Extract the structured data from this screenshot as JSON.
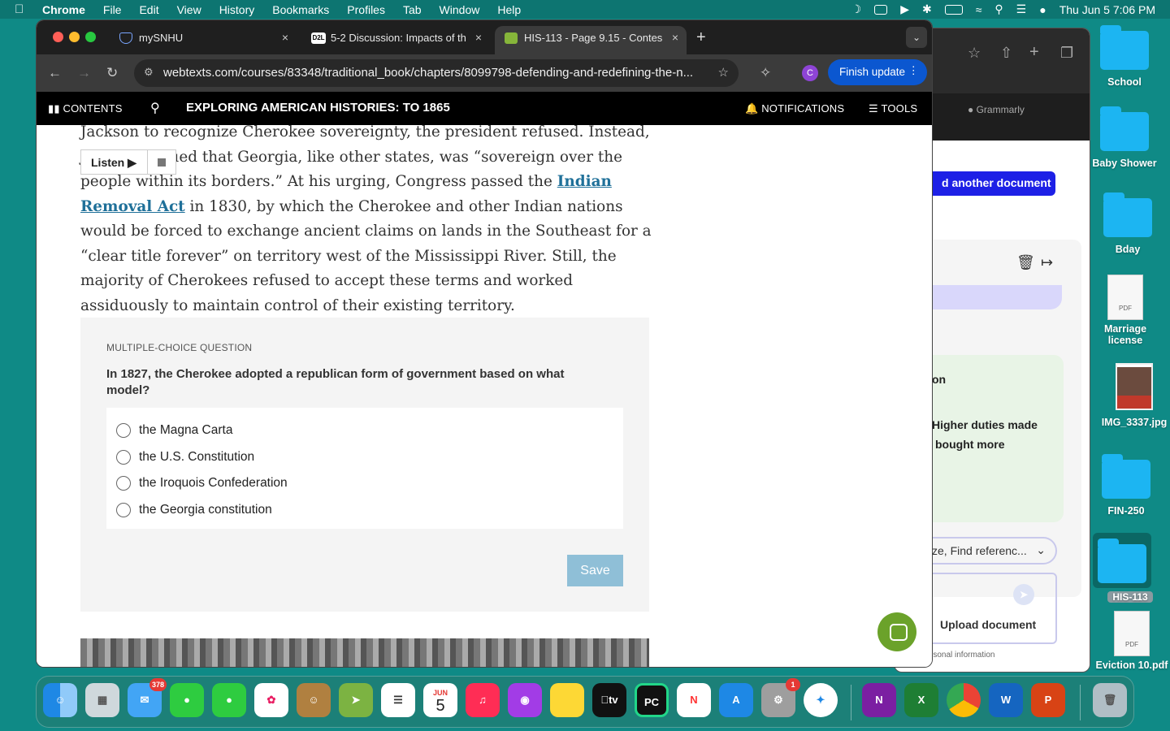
{
  "menubar": {
    "app": "Chrome",
    "items": [
      "File",
      "Edit",
      "View",
      "History",
      "Bookmarks",
      "Profiles",
      "Tab",
      "Window",
      "Help"
    ],
    "datetime": "Thu Jun 5  7:06 PM"
  },
  "desktop": {
    "icons": [
      "School",
      "Baby Shower",
      "Bday",
      "Marriage license",
      "IMG_3337.jpg",
      "FIN-250",
      "HIS-113",
      "Eviction 10.pdf"
    ],
    "pdf_label": "PDF"
  },
  "tabs": [
    {
      "title": "mySNHU",
      "close": "×"
    },
    {
      "title": "5-2 Discussion: Impacts of th",
      "close": "×",
      "favicon": "D2L"
    },
    {
      "title": "HIS-113 - Page 9.15 - Contes",
      "close": "×"
    }
  ],
  "toolbar": {
    "url": "webtexts.com/courses/83348/traditional_book/chapters/8099798-defending-and-redefining-the-n...",
    "profile_initial": "C",
    "finish_update": "Finish update"
  },
  "app_header": {
    "contents": "CONTENTS",
    "title": "EXPLORING AMERICAN HISTORIES: TO 1865",
    "notifications": "NOTIFICATIONS",
    "tools": "TOOLS"
  },
  "article": {
    "listen": "Listen",
    "text_before": "Jackson to recognize Cherokee sovereignty, the president refused. Instead, Jackson argued that Georgia, like other states, was “sovereign over the people within its borders.” At his urging, Congress passed the ",
    "link": "Indian Removal Act",
    "text_after": " in 1830, by which the Cherokee and other Indian nations would be forced to exchange ancient claims on lands in the Southeast for a “clear title forever” on territory west of the Mississippi River. Still, the majority of Cherokees refused to accept these terms and worked assiduously to maintain control of their existing territory."
  },
  "question": {
    "label": "MULTIPLE-CHOICE QUESTION",
    "text": "In 1827, the Cherokee adopted a republican form of government based on what model?",
    "options": [
      "the Magna Carta",
      "the U.S. Constitution",
      "the Iroquois Confederation",
      "the Georgia constitution"
    ],
    "save": "Save"
  },
  "grammarly": {
    "brand": "Grammarly",
    "add_doc": "d another document",
    "card_title": "on",
    "card_line1": "Higher duties made",
    "card_line2": "bought more",
    "dropdown": "ze, Find referenc...",
    "upload": "Upload document",
    "personal": "rsonal information"
  },
  "dock": {
    "mail_badge": "378",
    "settings_badge": "1",
    "calendar_month": "JUN",
    "calendar_day": "5",
    "tv_label": "tv"
  }
}
